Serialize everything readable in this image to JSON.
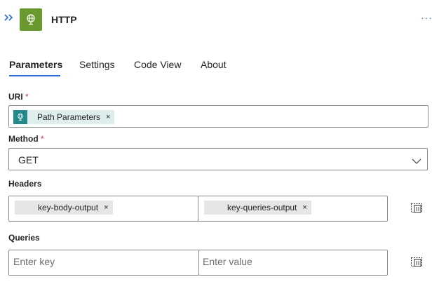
{
  "header": {
    "title": "HTTP",
    "expand_icon": "double-chevron-right-icon",
    "app_icon": "globe-icon",
    "more_label": "···"
  },
  "tabs": [
    {
      "label": "Parameters",
      "active": true
    },
    {
      "label": "Settings",
      "active": false
    },
    {
      "label": "Code View",
      "active": false
    },
    {
      "label": "About",
      "active": false
    }
  ],
  "uri": {
    "label": "URI",
    "required_mark": "*",
    "token": {
      "label": "Path Parameters",
      "close": "×",
      "icon": "globe-icon"
    }
  },
  "method": {
    "label": "Method",
    "required_mark": "*",
    "value": "GET",
    "icon": "chevron-down-icon"
  },
  "headers": {
    "label": "Headers",
    "key_token": {
      "label": "key-body-output",
      "close": "×"
    },
    "value_token": {
      "label": "key-queries-output",
      "close": "×"
    },
    "delete_icon": "delete-row-icon"
  },
  "queries": {
    "label": "Queries",
    "key_placeholder": "Enter key",
    "value_placeholder": "Enter value",
    "delete_icon": "delete-row-icon"
  },
  "colors": {
    "accent": "#2b6bd6",
    "app_icon_bg": "#6a9a2f",
    "token_bg": "#ddeeec",
    "token_icon_bg": "#23898a",
    "required": "#c4314b"
  }
}
